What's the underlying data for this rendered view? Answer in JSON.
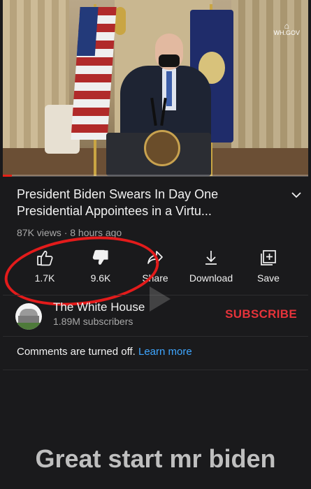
{
  "video": {
    "watermark_label": "WH.GOV",
    "progress_fraction": 0.03,
    "accent_color": "#e62117"
  },
  "info": {
    "title": "President Biden Swears In Day One Presidential Appointees in a Virtu...",
    "meta": "87K views · 8 hours ago",
    "expand_icon": "chevron-down-icon"
  },
  "actions": {
    "like": {
      "icon": "thumbs-up-icon",
      "label": "1.7K"
    },
    "dislike": {
      "icon": "thumbs-down-icon",
      "label": "9.6K"
    },
    "share": {
      "icon": "share-icon",
      "label": "Share"
    },
    "download": {
      "icon": "download-icon",
      "label": "Download"
    },
    "save": {
      "icon": "add-to-playlist-icon",
      "label": "Save"
    }
  },
  "channel": {
    "name": "The White House",
    "subscribers": "1.89M subscribers",
    "subscribe_label": "SUBSCRIBE",
    "subscribe_color": "#e6333a"
  },
  "comments": {
    "text": "Comments are turned off.",
    "link": "Learn more",
    "link_color": "#3ea6ff"
  },
  "caption": "Great start mr biden",
  "annotation": {
    "circle_color": "#e31b1b"
  }
}
